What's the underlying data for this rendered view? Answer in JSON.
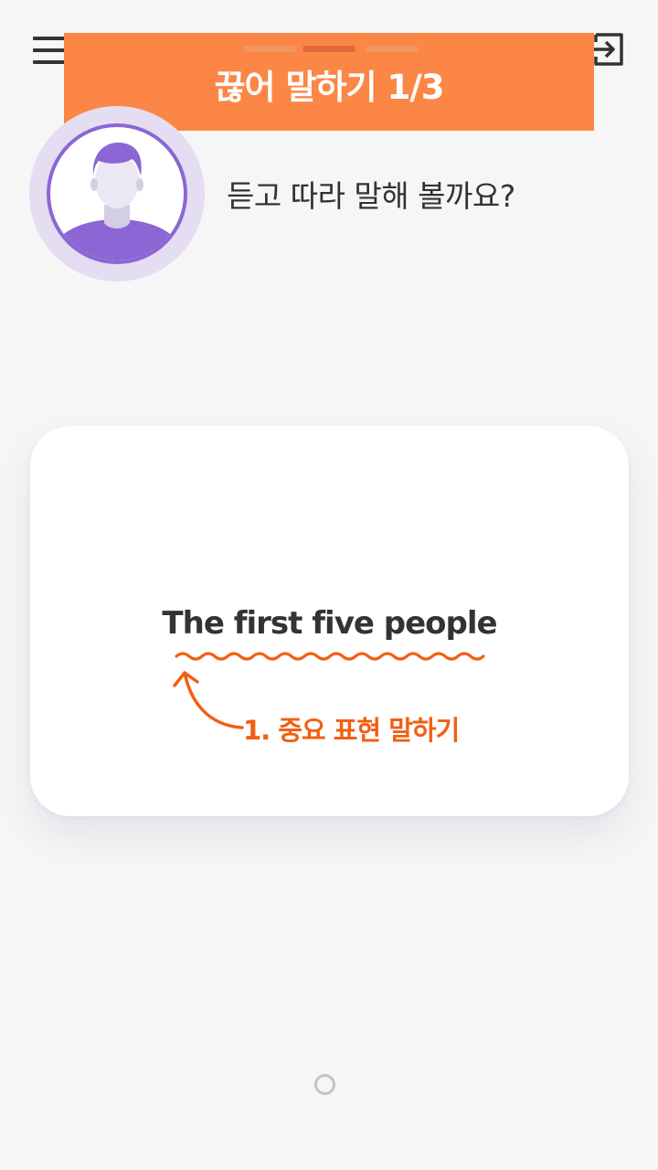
{
  "header": {
    "menu_icon": "hamburger-menu-icon",
    "exit_icon": "exit-icon",
    "progress": {
      "total": 3,
      "current": 2
    },
    "title": "끊어 말하기 1/3"
  },
  "instruction": {
    "avatar_icon": "user-avatar-icon",
    "text": "듣고 따라 말해 볼까요?"
  },
  "card": {
    "sentence": "The first five people",
    "label": "1. 중요 표현 말하기"
  },
  "footer": {
    "indicator_icon": "circle-indicator-icon"
  },
  "colors": {
    "accent": "#fb8646",
    "label": "#f25f12",
    "avatar": "#8c66d4",
    "background": "#f6f6f6"
  }
}
